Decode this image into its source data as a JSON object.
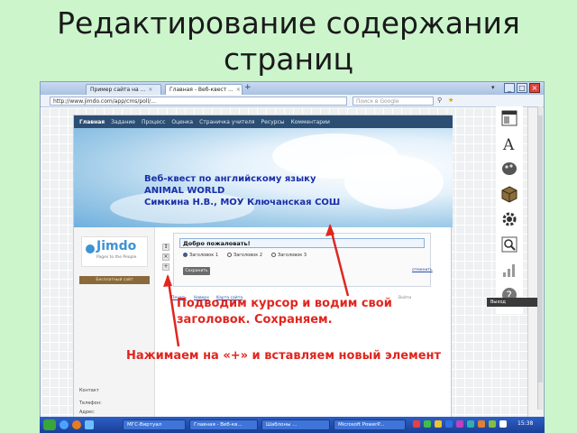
{
  "slide": {
    "title_line1": "Редактирование содержания",
    "title_line2": "страниц",
    "annotation_heading": "Подводим курсор и водим свой",
    "annotation_heading2": "заголовок. Сохраняем.",
    "annotation_plus": "Нажимаем на «+» и вставляем новый элемент"
  },
  "browser": {
    "tabs": [
      {
        "label": "Пример сайта на ..."
      },
      {
        "label": "Главная - Веб-квест ..."
      }
    ],
    "new_tab_label": "+",
    "url": "http://www.jimdo.com/app/cms/poll/...",
    "search_placeholder": "Поиск в Google"
  },
  "site": {
    "nav": [
      "Главная",
      "Задание",
      "Процесс",
      "Оценка",
      "Страничка учителя",
      "Ресурсы",
      "Комментарии"
    ],
    "banner_line1": "Веб-квест по английскому языку",
    "banner_line2": "ANIMAL WORLD",
    "banner_line3": "Симкина Н.В., МОУ Ключанская СОШ",
    "logo_word": "Jimdo",
    "logo_tagline": "Pages to the People",
    "brown_button": "Бесплатный сайт",
    "contact_heading": "Контакт",
    "contact_phone": "Телефон:",
    "contact_address": "Адрес:"
  },
  "editor": {
    "heading_value": "Добро пожаловать!",
    "radio_options": [
      "Заголовок 1",
      "Заголовок 2",
      "Заголовок 3"
    ],
    "save_label": "Сохранить",
    "cancel_label": "отменить",
    "footer_links": [
      "Печать",
      "Наверх",
      "Карта сайта"
    ],
    "footer_right": "Войти"
  },
  "panel": {
    "logout_label": "Выход"
  },
  "taskbar": {
    "items": [
      "МГС-Виртуал",
      "Главная - Веб-кв...",
      "Шаблоны ...",
      "Microsoft PowerP..."
    ],
    "clock": "15:38"
  },
  "colors": {
    "background": "#ccf5cc",
    "annotation": "#e0261f",
    "banner_text": "#1a2fa8",
    "nav": "#2c4e73"
  }
}
